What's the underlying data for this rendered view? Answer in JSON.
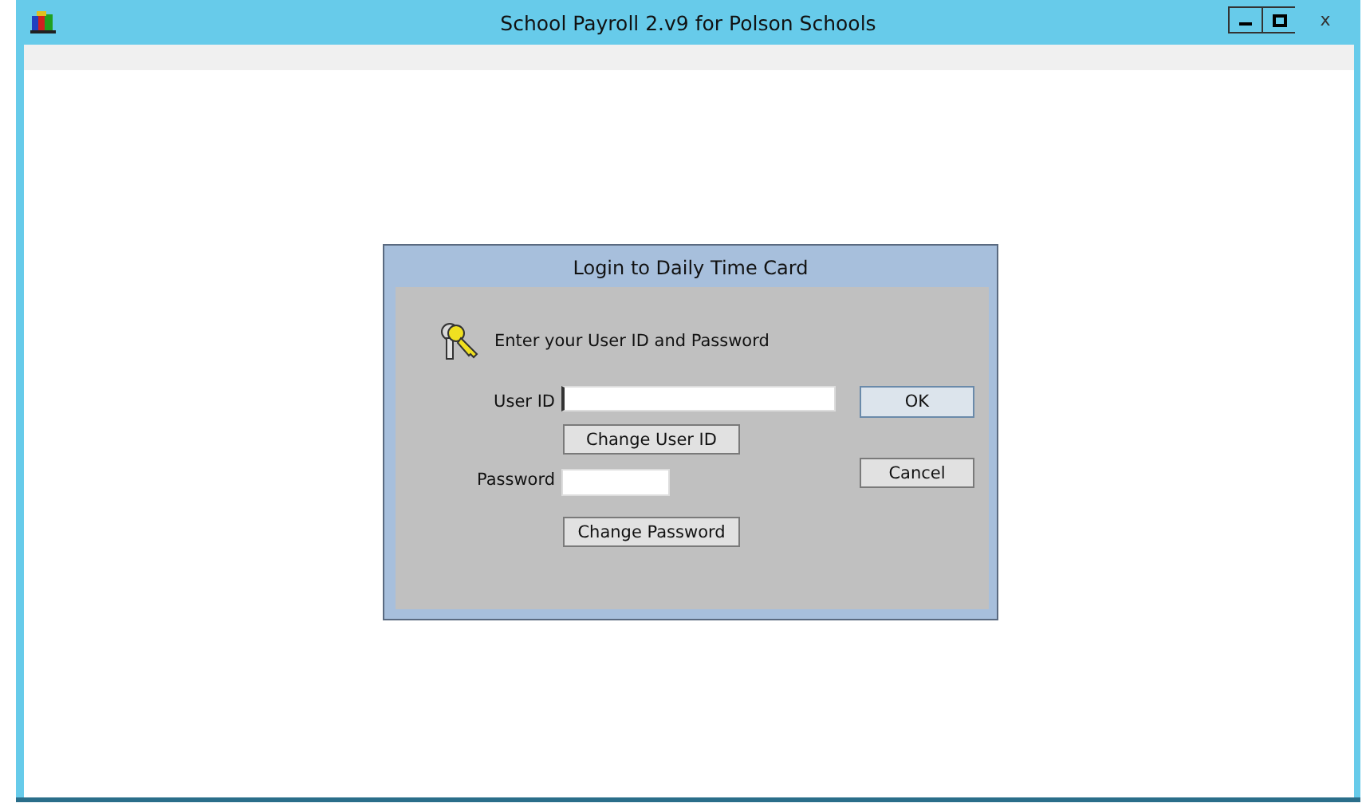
{
  "window": {
    "title": "School Payroll 2.v9 for Polson Schools",
    "close": "x"
  },
  "dialog": {
    "title": "Login to Daily Time Card",
    "prompt": "Enter your User ID and Password",
    "user_id": {
      "label": "User ID"
    },
    "password": {
      "label": "Password"
    },
    "buttons": {
      "ok": "OK",
      "cancel": "Cancel",
      "change_user_id": "Change User ID",
      "change_password": "Change Password"
    }
  }
}
